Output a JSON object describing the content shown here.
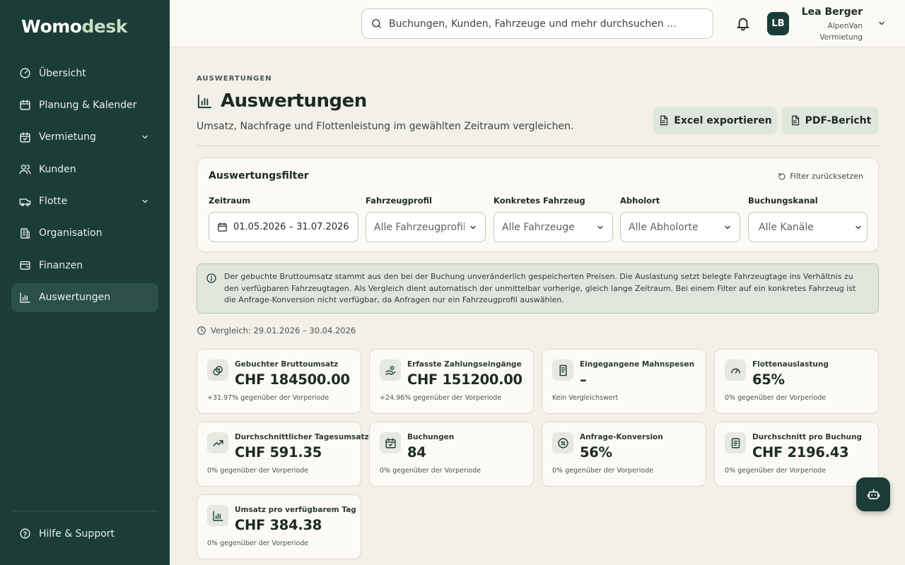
{
  "app": {
    "logo_part1": "W",
    "logo_part2": "omo",
    "logo_part3": "desk"
  },
  "sidebar": {
    "items": [
      {
        "label": "Übersicht",
        "icon": "gauge-icon"
      },
      {
        "label": "Planung & Kalender",
        "icon": "calendar-icon"
      },
      {
        "label": "Vermietung",
        "icon": "calendar-check-icon",
        "expandable": true
      },
      {
        "label": "Kunden",
        "icon": "users-icon"
      },
      {
        "label": "Flotte",
        "icon": "van-icon",
        "expandable": true
      },
      {
        "label": "Organisation",
        "icon": "building-icon"
      },
      {
        "label": "Finanzen",
        "icon": "wallet-icon"
      },
      {
        "label": "Auswertungen",
        "icon": "bar-chart-icon",
        "active": true
      }
    ],
    "help_label": "Hilfe & Support"
  },
  "topbar": {
    "search_placeholder": "Buchungen, Kunden, Fahrzeuge und mehr durchsuchen ...",
    "avatar_initials": "LB",
    "user_name": "Lea Berger",
    "user_org": "AlpenVan Vermietung"
  },
  "page": {
    "eyebrow": "AUSWERTUNGEN",
    "title": "Auswertungen",
    "subtitle": "Umsatz, Nachfrage und Flottenleistung im gewählten Zeitraum vergleichen.",
    "excel_button": "Excel exportieren",
    "pdf_button": "PDF-Bericht"
  },
  "filters": {
    "title": "Auswertungsfilter",
    "reset_label": "Filter zurücksetzen",
    "period_label": "Zeitraum",
    "period_value": "01.05.2026 – 31.07.2026",
    "profile_label": "Fahrzeugprofil",
    "profile_value": "Alle Fahrzeugprofile",
    "vehicle_label": "Konkretes Fahrzeug",
    "vehicle_value": "Alle Fahrzeuge",
    "pickup_label": "Abholort",
    "pickup_value": "Alle Abholorte",
    "channel_label": "Buchungskanal",
    "channel_value": "Alle Kanäle"
  },
  "info": {
    "text": "Der gebuchte Bruttoumsatz stammt aus den bei der Buchung unveränderlich gespeicherten Preisen. Die Auslastung setzt belegte Fahrzeugtage ins Verhältnis zu den verfügbaren Fahrzeugtagen. Als Vergleich dient automatisch der unmittelbar vorherige, gleich lange Zeitraum. Bei einem Filter auf ein konkretes Fahrzeug ist die Anfrage-Konversion nicht verfügbar, da Anfragen nur ein Fahrzeugprofil auswählen."
  },
  "compare_label": "Vergleich: 29.01.2026 – 30.04.2026",
  "kpis": [
    {
      "label": "Gebuchter Bruttoumsatz",
      "value": "CHF 184500.00",
      "delta": "+31.97% gegenüber der Vorperiode",
      "icon": "coins-icon"
    },
    {
      "label": "Erfasste Zahlungseingänge",
      "value": "CHF 151200.00",
      "delta": "+24.96% gegenüber der Vorperiode",
      "icon": "hand-coins-icon"
    },
    {
      "label": "Eingegangene Mahnspesen",
      "value": "–",
      "delta": "Kein Vergleichswert",
      "icon": "receipt-icon"
    },
    {
      "label": "Flottenauslastung",
      "value": "65%",
      "delta": "0% gegenüber der Vorperiode",
      "icon": "gauge-icon"
    },
    {
      "label": "Durchschnittlicher Tagesumsatz",
      "value": "CHF 591.35",
      "delta": "0% gegenüber der Vorperiode",
      "icon": "trending-up-icon"
    },
    {
      "label": "Buchungen",
      "value": "84",
      "delta": "0% gegenüber der Vorperiode",
      "icon": "calendar-check-icon"
    },
    {
      "label": "Anfrage-Konversion",
      "value": "56%",
      "delta": "0% gegenüber der Vorperiode",
      "icon": "percent-icon"
    },
    {
      "label": "Durchschnitt pro Buchung",
      "value": "CHF 2196.43",
      "delta": "0% gegenüber der Vorperiode",
      "icon": "document-icon"
    },
    {
      "label": "Umsatz pro verfügbarem Tag",
      "value": "CHF 384.38",
      "delta": "0% gegenüber der Vorperiode",
      "icon": "bar-chart-icon"
    }
  ],
  "colors": {
    "sidebar_bg": "#1c3d37",
    "sidebar_active": "#2b504a",
    "page_bg": "#f2f0e8",
    "accent_light": "#c4dfc4"
  }
}
